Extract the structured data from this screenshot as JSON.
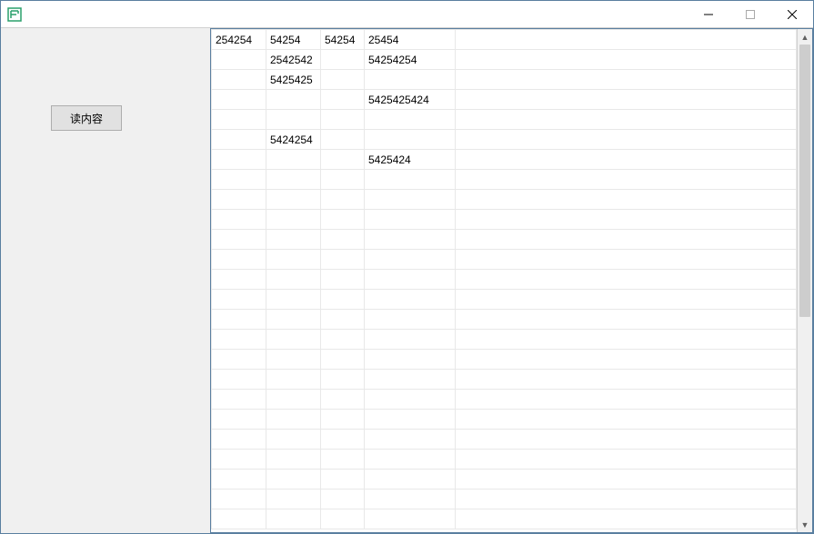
{
  "window": {
    "title": ""
  },
  "sidebar": {
    "read_button_label": "读内容"
  },
  "grid": {
    "column_count": 5,
    "row_count": 25,
    "rows": [
      [
        "254254",
        "54254",
        "54254",
        "25454",
        ""
      ],
      [
        "",
        "2542542",
        "",
        "54254254",
        ""
      ],
      [
        "",
        "5425425",
        "",
        "",
        ""
      ],
      [
        "",
        "",
        "",
        "5425425424",
        ""
      ],
      [
        "",
        "",
        "",
        "",
        ""
      ],
      [
        "",
        "5424254",
        "",
        "",
        ""
      ],
      [
        "",
        "",
        "",
        "5425424",
        ""
      ],
      [
        "",
        "",
        "",
        "",
        ""
      ],
      [
        "",
        "",
        "",
        "",
        ""
      ],
      [
        "",
        "",
        "",
        "",
        ""
      ],
      [
        "",
        "",
        "",
        "",
        ""
      ],
      [
        "",
        "",
        "",
        "",
        ""
      ],
      [
        "",
        "",
        "",
        "",
        ""
      ],
      [
        "",
        "",
        "",
        "",
        ""
      ],
      [
        "",
        "",
        "",
        "",
        ""
      ],
      [
        "",
        "",
        "",
        "",
        ""
      ],
      [
        "",
        "",
        "",
        "",
        ""
      ],
      [
        "",
        "",
        "",
        "",
        ""
      ],
      [
        "",
        "",
        "",
        "",
        ""
      ],
      [
        "",
        "",
        "",
        "",
        ""
      ],
      [
        "",
        "",
        "",
        "",
        ""
      ],
      [
        "",
        "",
        "",
        "",
        ""
      ],
      [
        "",
        "",
        "",
        "",
        ""
      ],
      [
        "",
        "",
        "",
        "",
        ""
      ],
      [
        "",
        "",
        "",
        "",
        ""
      ]
    ]
  }
}
